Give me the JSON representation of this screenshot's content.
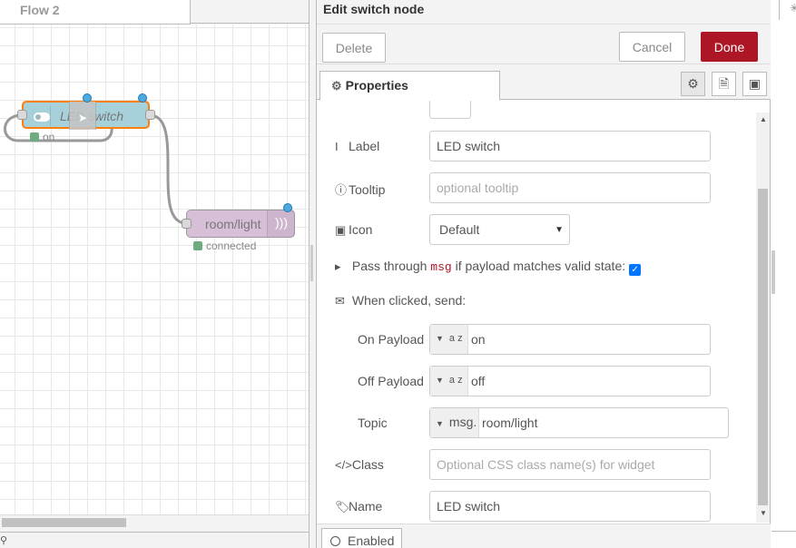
{
  "workspace": {
    "flow_tab": "Flow 2",
    "switch_node": {
      "label": "LED switch",
      "status": "on"
    },
    "mqtt_node": {
      "label": "room/light",
      "status": "connected"
    }
  },
  "tray": {
    "title": "Edit switch node",
    "buttons": {
      "delete": "Delete",
      "cancel": "Cancel",
      "done": "Done"
    },
    "tab": "Properties",
    "colors": {
      "done": "#ad1625",
      "msg_keyword": "#ad1625",
      "checkbox": "#0075ff"
    },
    "form": {
      "label": {
        "label": "Label",
        "value": "LED switch"
      },
      "tooltip": {
        "label": "Tooltip",
        "placeholder": "optional tooltip"
      },
      "icon": {
        "label": "Icon",
        "value": "Default"
      },
      "passthru": {
        "prefix": "Pass through",
        "keyword": "msg",
        "suffix": "if payload matches valid state:",
        "checked": true
      },
      "when_clicked": "When clicked, send:",
      "on_payload": {
        "label": "On Payload",
        "type": "a z",
        "value": "on"
      },
      "off_payload": {
        "label": "Off Payload",
        "type": "a z",
        "value": "off"
      },
      "topic": {
        "label": "Topic",
        "type": "msg.",
        "value": "room/light"
      },
      "class": {
        "label": "Class",
        "placeholder": "Optional CSS class name(s) for widget"
      },
      "name": {
        "label": "Name",
        "value": "LED switch"
      }
    },
    "footer": {
      "enabled": "Enabled"
    }
  }
}
